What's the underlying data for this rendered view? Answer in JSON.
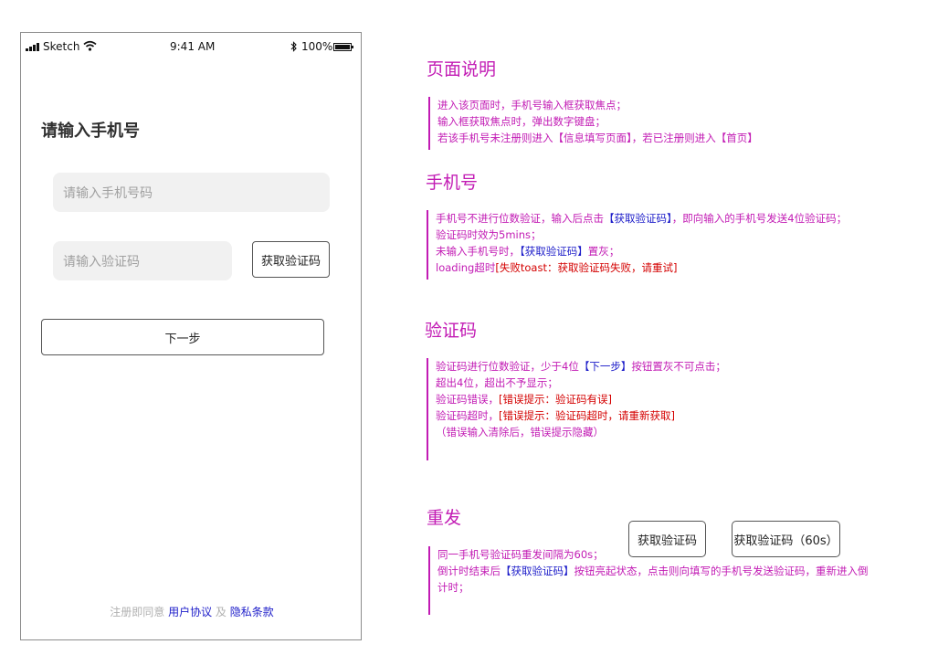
{
  "status_bar": {
    "carrier": "Sketch",
    "time": "9:41 AM",
    "battery": "100%"
  },
  "login": {
    "title": "请输入手机号",
    "phone_placeholder": "请输入手机号码",
    "code_placeholder": "请输入验证码",
    "get_code_label": "获取验证码",
    "next_label": "下一步",
    "agreement_prefix": "注册即同意",
    "user_agreement": "用户协议",
    "and": "及",
    "privacy_policy": "隐私条款"
  },
  "annotations": {
    "page": {
      "title": "页面说明",
      "line1": "进入该页面时，手机号输入框获取焦点；",
      "line2": "输入框获取焦点时，弹出数字键盘；",
      "line3": "若该手机号未注册则进入【信息填写页面】，若已注册则进入【首页】"
    },
    "phone": {
      "title": "手机号",
      "l1a": "手机号不进行位数验证，输入后点击",
      "l1b": "【获取验证码】",
      "l1c": "，即向输入的手机号发送4位验证码；",
      "line2": "验证码时效为5mins；",
      "l3a": "未输入手机号时，",
      "l3b": "【获取验证码】",
      "l3c": "置灰；",
      "l4a": "loading超时",
      "l4b": "[失败toast：获取验证码失败，请重试]"
    },
    "code": {
      "title": "验证码",
      "l1a": "验证码进行位数验证，少于4位",
      "l1b": "【下一步】",
      "l1c": "按钮置灰不可点击；",
      "line2": "超出4位，超出不予显示；",
      "l3a": "验证码错误，",
      "l3b": "[错误提示：验证码有误]",
      "l4a": "验证码超时，",
      "l4b": "[错误提示：验证码超时，请重新获取]",
      "line5": "（错误输入清除后，错误提示隐藏）"
    },
    "resend": {
      "title": "重发",
      "line1": "同一手机号验证码重发间隔为60s；",
      "l2a": "倒计时结束后",
      "l2b": "【获取验证码】",
      "l2c": "按钮亮起状态，点击则向填写的手机号发送验证码，重新进入倒",
      "line3": "计时；",
      "btn_normal": "获取验证码",
      "btn_countdown": "获取验证码（60s）"
    }
  }
}
